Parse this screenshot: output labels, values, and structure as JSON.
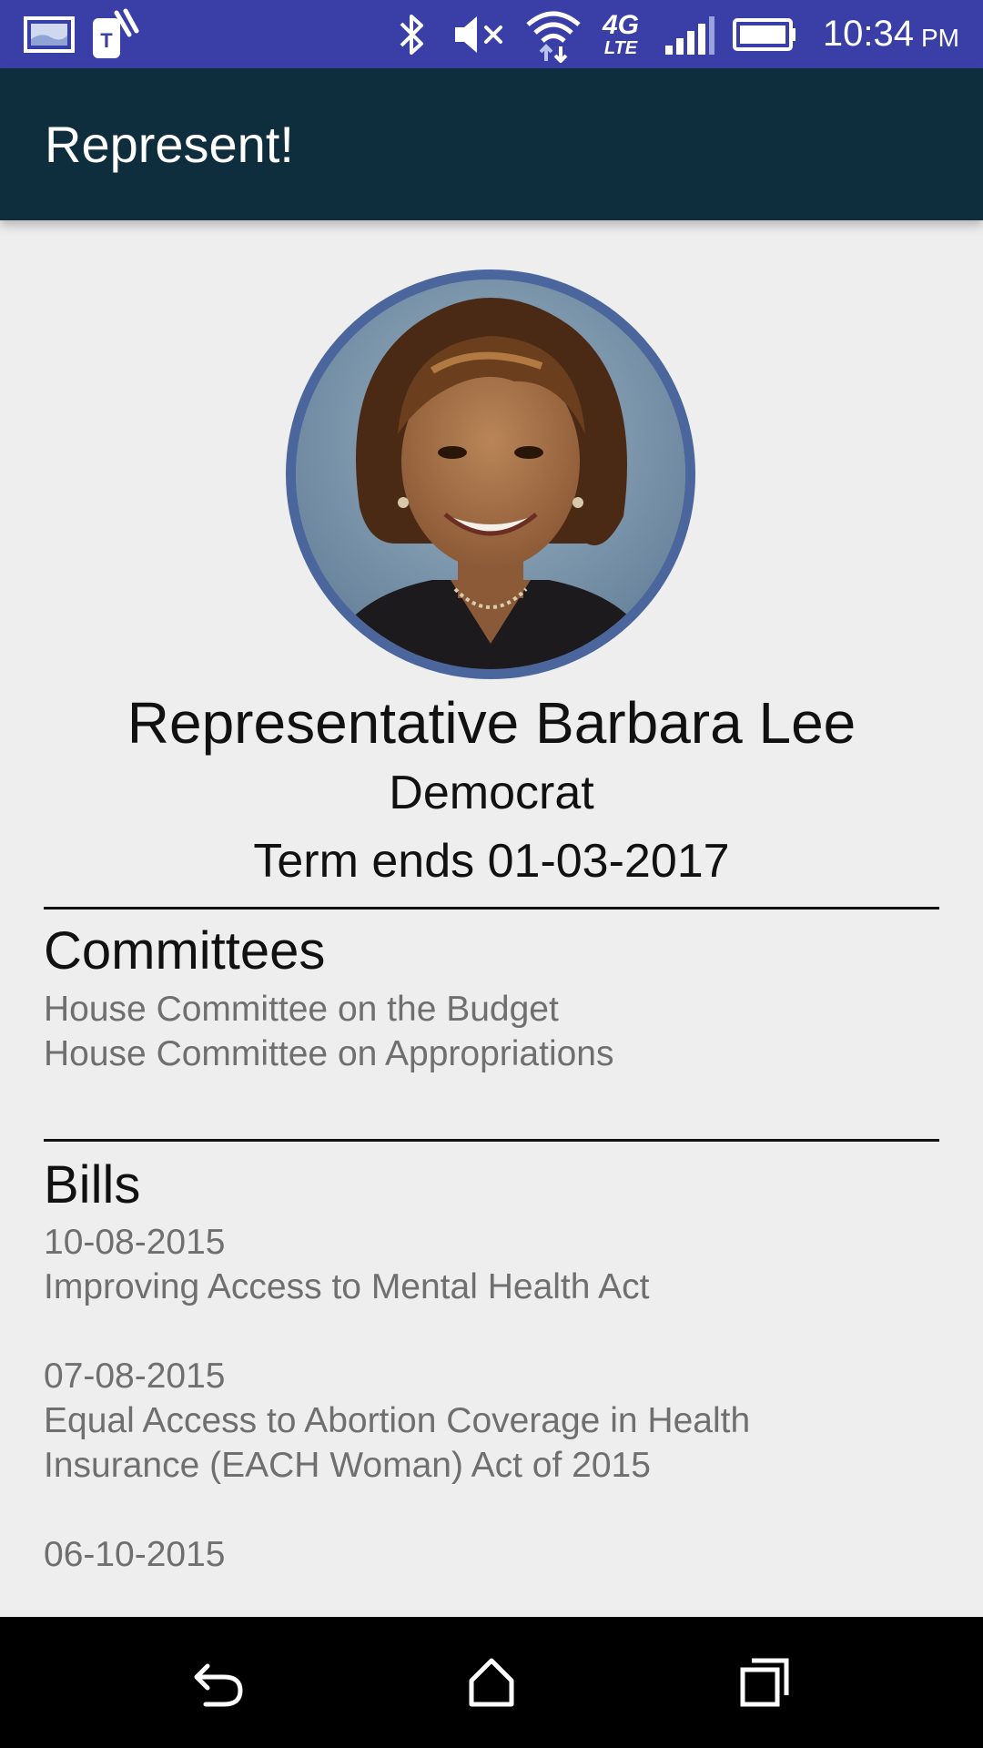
{
  "status_bar": {
    "time": "10:34",
    "ampm": "PM",
    "icons": [
      "gallery-notification-icon",
      "tmobile-notification-icon",
      "bluetooth-icon",
      "mute-icon",
      "wifi-icon",
      "lte-icon",
      "signal-icon",
      "battery-icon"
    ],
    "network_label": "4G",
    "lte_label": "LTE"
  },
  "app_bar": {
    "title": "Represent!"
  },
  "representative": {
    "name": "Representative Barbara Lee",
    "party": "Democrat",
    "term": "Term ends 01-03-2017"
  },
  "committees": {
    "title": "Committees",
    "items": [
      "House Committee on the Budget",
      "House Committee on Appropriations"
    ]
  },
  "bills": {
    "title": "Bills",
    "items": [
      {
        "date": "10-08-2015",
        "name_lines": [
          "Improving Access to Mental Health Act"
        ]
      },
      {
        "date": "07-08-2015",
        "name_lines": [
          "Equal Access to Abortion Coverage in Health",
          "Insurance (EACH Woman) Act of 2015"
        ]
      },
      {
        "date": "06-10-2015",
        "name_lines": []
      }
    ]
  },
  "nav_bar": {
    "buttons": [
      "back-icon",
      "home-icon",
      "recents-icon"
    ]
  },
  "colors": {
    "status_bar": "#3a3fa8",
    "app_bar": "#0f2e3d",
    "background": "#eeeeef",
    "avatar_border": "#4a669c",
    "secondary_text": "#6f6f6f"
  }
}
